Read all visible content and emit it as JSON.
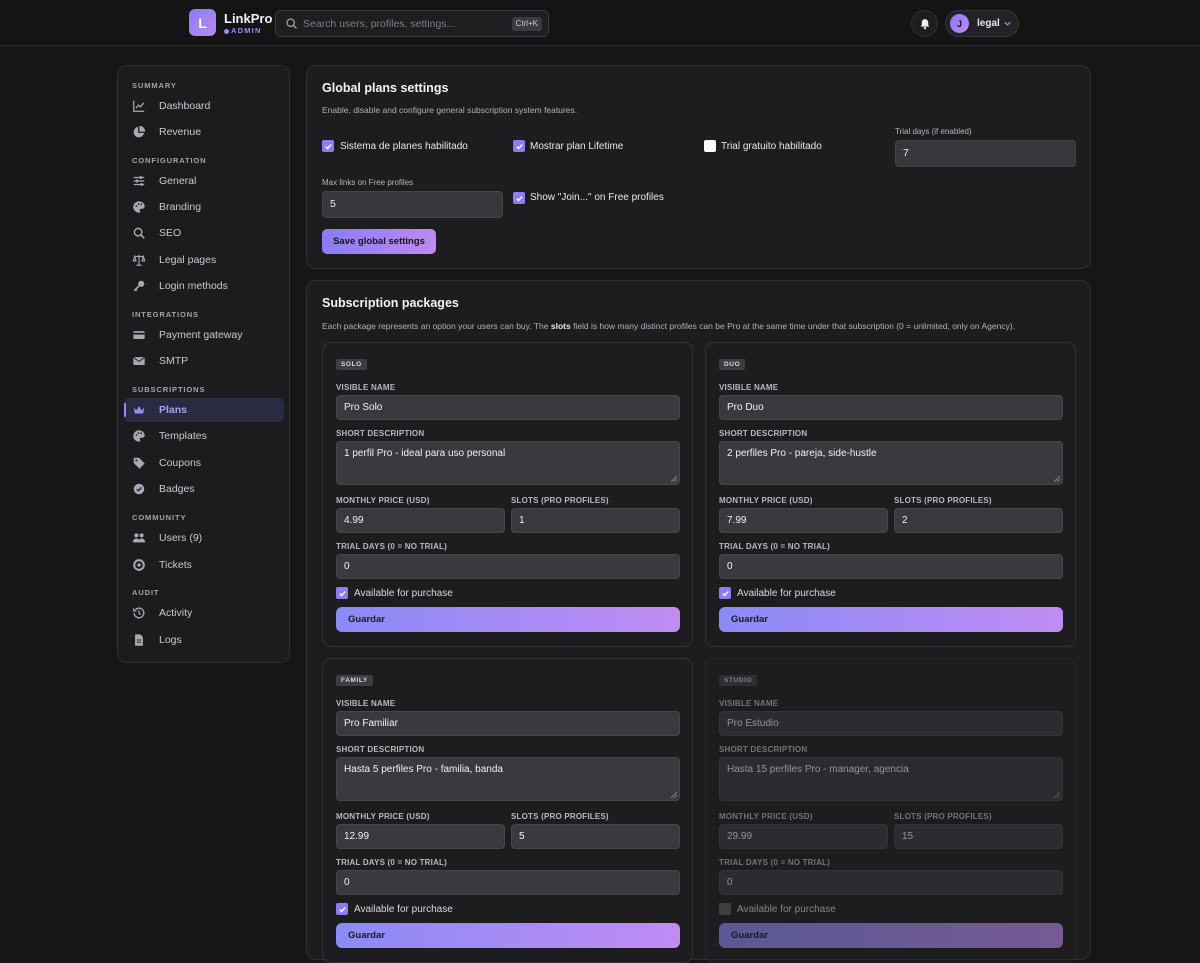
{
  "topbar": {
    "logo_letter": "L",
    "brand": "LinkPro",
    "brand_sub": "ADMIN",
    "search_placeholder": "Search users, profiles, settings...",
    "search_shortcut": "Ctrl+K",
    "user_initial": "J",
    "user_name": "legal"
  },
  "sidebar": {
    "sections": [
      {
        "title": "SUMMARY",
        "items": [
          {
            "label": "Dashboard",
            "icon": "chart-line-icon"
          },
          {
            "label": "Revenue",
            "icon": "pie-chart-icon"
          }
        ]
      },
      {
        "title": "CONFIGURATION",
        "items": [
          {
            "label": "General",
            "icon": "sliders-icon"
          },
          {
            "label": "Branding",
            "icon": "palette-icon"
          },
          {
            "label": "SEO",
            "icon": "search-icon"
          },
          {
            "label": "Legal pages",
            "icon": "scale-icon"
          },
          {
            "label": "Login methods",
            "icon": "key-icon"
          }
        ]
      },
      {
        "title": "INTEGRATIONS",
        "items": [
          {
            "label": "Payment gateway",
            "icon": "credit-card-icon"
          },
          {
            "label": "SMTP",
            "icon": "envelope-icon"
          }
        ]
      },
      {
        "title": "SUBSCRIPTIONS",
        "items": [
          {
            "label": "Plans",
            "icon": "crown-icon",
            "active": true
          },
          {
            "label": "Templates",
            "icon": "palette-icon"
          },
          {
            "label": "Coupons",
            "icon": "tag-icon"
          },
          {
            "label": "Badges",
            "icon": "badge-check-icon"
          }
        ]
      },
      {
        "title": "COMMUNITY",
        "items": [
          {
            "label": "Users (9)",
            "icon": "users-icon"
          },
          {
            "label": "Tickets",
            "icon": "lifebuoy-icon"
          }
        ]
      },
      {
        "title": "AUDIT",
        "items": [
          {
            "label": "Activity",
            "icon": "history-icon"
          },
          {
            "label": "Logs",
            "icon": "file-icon"
          }
        ]
      }
    ]
  },
  "global": {
    "title": "Global plans settings",
    "subtitle": "Enable, disable and configure general subscription system features.",
    "plans_enabled_label": "Sistema de planes habilitado",
    "plans_enabled": true,
    "lifetime_label": "Mostrar plan Lifetime",
    "lifetime": true,
    "trial_label": "Trial gratuito habilitado",
    "trial": false,
    "trial_days_label": "Trial days (if enabled)",
    "trial_days": "7",
    "max_links_label": "Max links on Free profiles",
    "max_links": "5",
    "join_label": "Show \"Join...\" on Free profiles",
    "join": true,
    "save_label": "Save global settings"
  },
  "packages": {
    "title": "Subscription packages",
    "desc_before": "Each package represents an option your users can buy. The ",
    "desc_bold": "slots",
    "desc_after": " field is how many distinct profiles can be Pro at the same time under that subscription (0 = unlimited, only on Agency).",
    "labels": {
      "name": "VISIBLE NAME",
      "description": "SHORT DESCRIPTION",
      "price": "MONTHLY PRICE (USD)",
      "slots": "SLOTS (PRO PROFILES)",
      "trial": "TRIAL DAYS (0 = NO TRIAL)",
      "available": "Available for purchase",
      "save": "Guardar"
    },
    "items": [
      {
        "tag": "SOLO",
        "name": "Pro Solo",
        "description": "1 perfil Pro - ideal para uso personal",
        "price": "4.99",
        "slots": "1",
        "trial": "0",
        "available": true
      },
      {
        "tag": "DUO",
        "name": "Pro Duo",
        "description": "2 perfiles Pro - pareja, side-hustle",
        "price": "7.99",
        "slots": "2",
        "trial": "0",
        "available": true
      },
      {
        "tag": "FAMILY",
        "name": "Pro Familiar",
        "description": "Hasta 5 perfiles Pro - familia, banda",
        "price": "12.99",
        "slots": "5",
        "trial": "0",
        "available": true
      },
      {
        "tag": "STUDIO",
        "name": "Pro Estudio",
        "description": "Hasta 15 perfiles Pro - manager, agencia",
        "price": "29.99",
        "slots": "15",
        "trial": "0",
        "available": false
      }
    ]
  },
  "colors": {
    "accent": "#8b7bf5",
    "accent_end": "#bd8af2",
    "background": "#161617",
    "panel": "#1d1d20"
  }
}
